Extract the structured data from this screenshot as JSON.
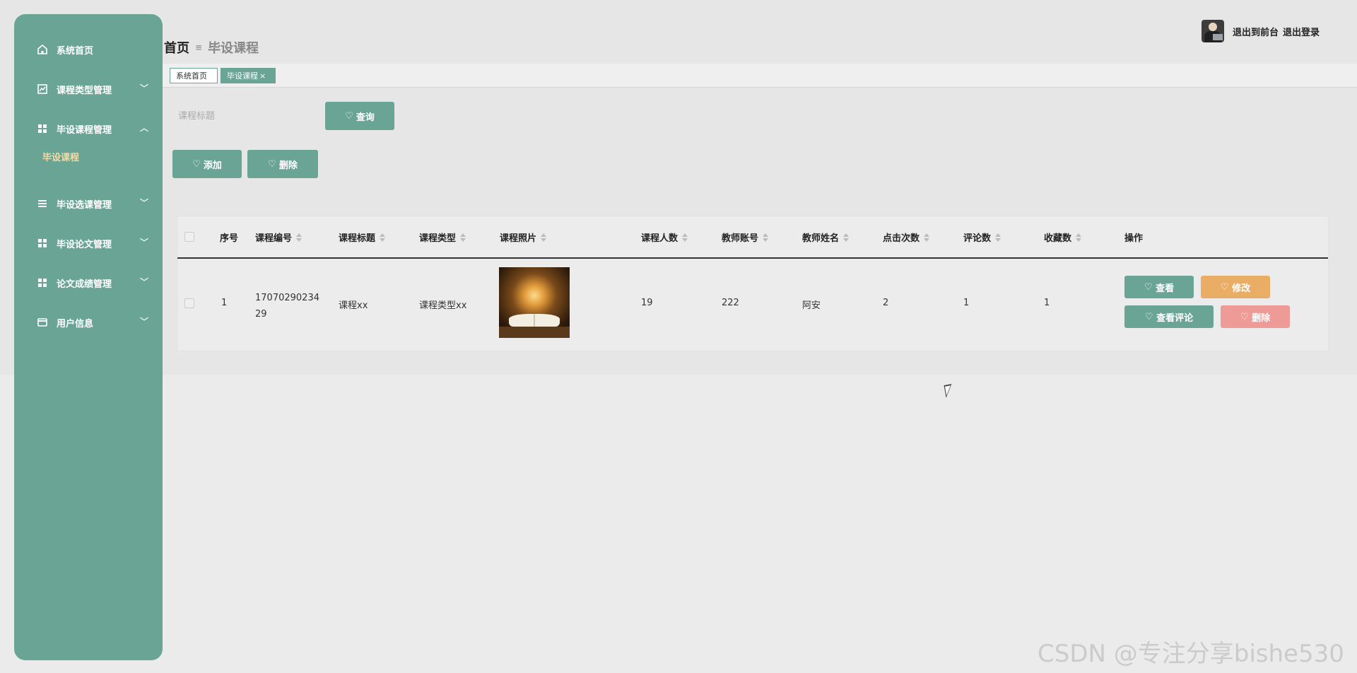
{
  "sidebar": {
    "items": [
      {
        "label": "系统首页",
        "icon": "home-icon",
        "has_arrow": false
      },
      {
        "label": "课程类型管理",
        "icon": "chart-icon",
        "has_arrow": true
      },
      {
        "label": "毕设课程管理",
        "icon": "grid-icon",
        "has_arrow": true,
        "expanded": true
      },
      {
        "label": "毕设选课管理",
        "icon": "list-icon",
        "has_arrow": true
      },
      {
        "label": "毕设论文管理",
        "icon": "grid-icon",
        "has_arrow": true
      },
      {
        "label": "论文成绩管理",
        "icon": "grid-icon",
        "has_arrow": true
      },
      {
        "label": "用户信息",
        "icon": "window-icon",
        "has_arrow": true
      }
    ],
    "submenu_active": "毕设课程",
    "colors": {
      "background": "#6aa494",
      "active_sub": "#f1dca7"
    }
  },
  "header": {
    "breadcrumb_home": "首页",
    "breadcrumb_sep": "≡",
    "breadcrumb_current": "毕设课程",
    "link_frontend": "退出到前台",
    "link_logout": "退出登录"
  },
  "tabs": [
    {
      "label": "系统首页"
    },
    {
      "label": "毕设课程",
      "close": "×"
    }
  ],
  "search": {
    "placeholder": "课程标题",
    "query_label": "查询"
  },
  "actions": {
    "add_label": "添加",
    "delete_label": "删除"
  },
  "table": {
    "columns": [
      "序号",
      "课程编号",
      "课程标题",
      "课程类型",
      "课程照片",
      "课程人数",
      "教师账号",
      "教师姓名",
      "点击次数",
      "评论数",
      "收藏数",
      "操作"
    ],
    "rows": [
      {
        "index": "1",
        "course_no_line1": "17070290234",
        "course_no_line2": "29",
        "title": "课程xx",
        "type": "课程类型xx",
        "students": "19",
        "teacher_account": "222",
        "teacher_name": "阿安",
        "clicks": "2",
        "comments": "1",
        "favorites": "1"
      }
    ],
    "row_actions": {
      "view": "查看",
      "edit": "修改",
      "view_comments": "查看评论",
      "delete": "删除"
    }
  },
  "watermark": "CSDN @专注分享bishe530",
  "colors": {
    "primary": "#6aa494",
    "warning": "#e9ad66",
    "danger": "#ee9a97"
  }
}
